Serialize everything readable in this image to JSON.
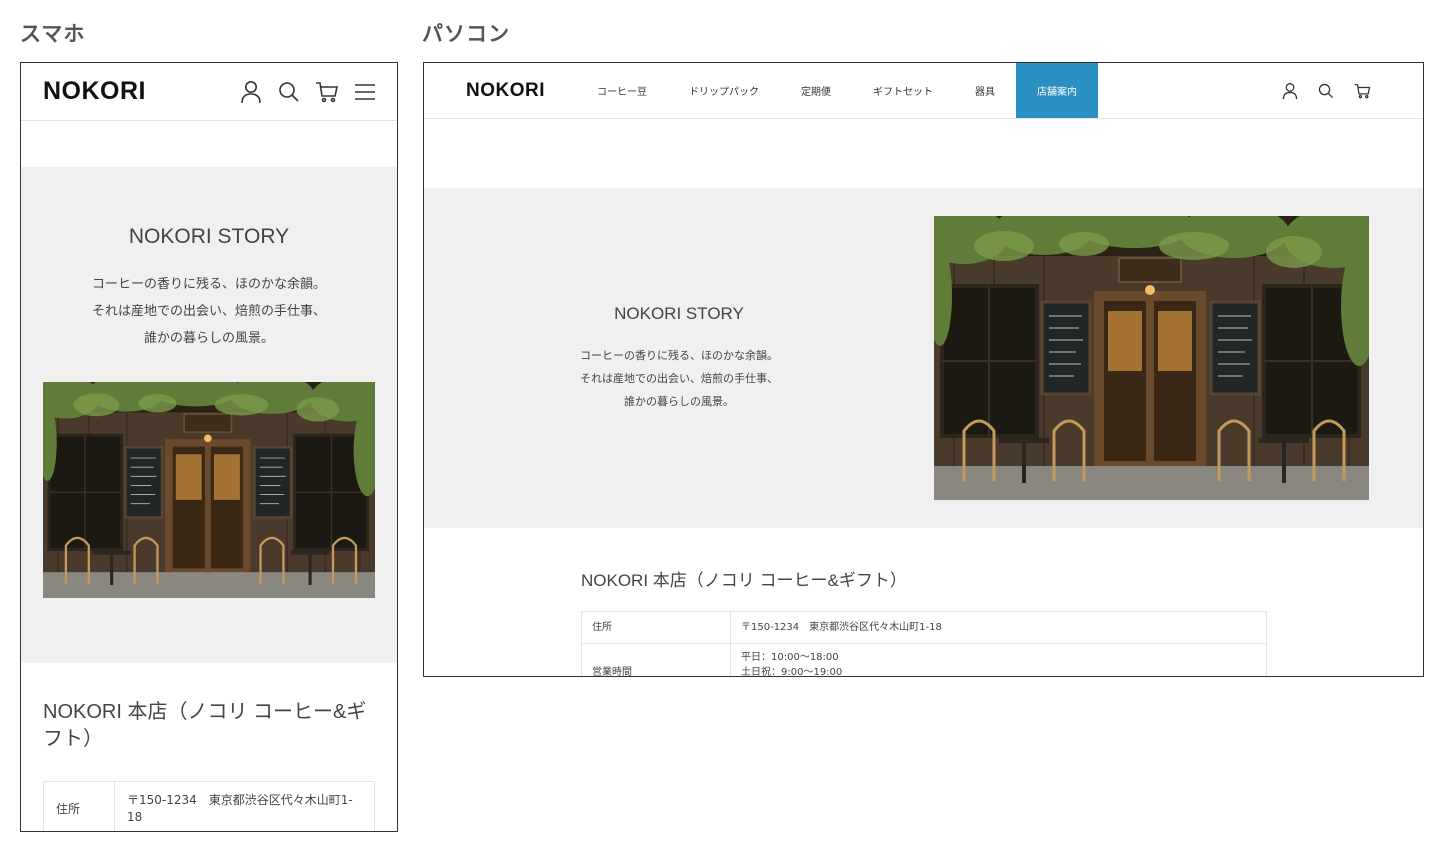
{
  "labels": {
    "smartphone": "スマホ",
    "pc": "パソコン"
  },
  "brand": {
    "logo": "NOKORI",
    "accent_color": "#2a8fc1"
  },
  "header_icons": [
    "account-icon",
    "search-icon",
    "cart-icon",
    "menu-icon"
  ],
  "nav": {
    "items": [
      {
        "label": "コーヒー豆"
      },
      {
        "label": "ドリップパック"
      },
      {
        "label": "定期便"
      },
      {
        "label": "ギフトセット"
      },
      {
        "label": "器具"
      },
      {
        "label": "店舗案内",
        "active": true
      }
    ]
  },
  "story": {
    "title": "NOKORI STORY",
    "lines": [
      "コーヒーの香りに残る、ほのかな余韻。",
      "それは産地での出会い、焙煎の手仕事、",
      "誰かの暮らしの風景。"
    ],
    "image_alt": "cafe-storefront-photo"
  },
  "store": {
    "title": "NOKORI 本店（ノコリ コーヒー&ギフト）",
    "address_label": "住所",
    "address_value": "〒150-1234　東京都渋谷区代々木山町1-18",
    "hours_label": "営業時間",
    "hours_weekday": "平日：10:00〜18:00",
    "hours_weekend": "土日祝：9:00〜19:00"
  }
}
